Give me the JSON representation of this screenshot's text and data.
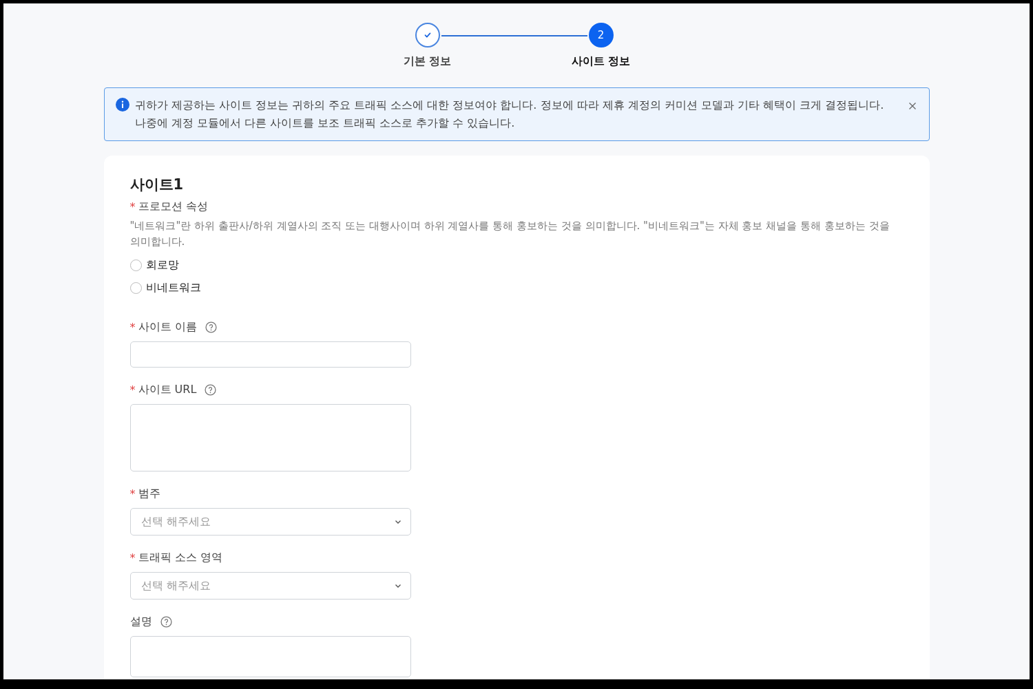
{
  "stepper": [
    {
      "completed": true,
      "selected": false,
      "label": "기본 정보"
    },
    {
      "completed": false,
      "selected": true,
      "number": "2",
      "label": "사이트 정보"
    }
  ],
  "notice": {
    "text": "귀하가 제공하는 사이트 정보는 귀하의 주요 트래픽 소스에 대한 정보여야 합니다. 정보에 따라 제휴 계정의 커미션 모델과 기타 혜택이 크게 결정됩니다. 나중에 계정 모듈에서 다른 사이트를 보조 트래픽 소스로 추가할 수 있습니다.",
    "closable": true
  },
  "form": {
    "title": "사이트1",
    "fields": [
      {
        "kind": "radio",
        "required_mark": "*",
        "label": "프로모션 속성",
        "help": false,
        "description": "\"네트워크\"란 하위 출판사/하위 계열사의 조직 또는 대행사이며 하위 계열사를 통해 홍보하는 것을 의미합니다. \"비네트워크\"는 자체 홍보 채널을 통해 홍보하는 것을 의미합니다.",
        "options": [
          {
            "label": "회로망",
            "selected": false
          },
          {
            "label": "비네트워크",
            "selected": false
          }
        ]
      },
      {
        "kind": "text",
        "required_mark": "*",
        "label": "사이트 이름",
        "help": true
      },
      {
        "kind": "textarea",
        "required_mark": "*",
        "label": "사이트 URL",
        "help": true
      },
      {
        "kind": "select",
        "required_mark": "*",
        "label": "범주",
        "help": false,
        "placeholder": "선택 해주세요"
      },
      {
        "kind": "select",
        "required_mark": "*",
        "label": "트래픽 소스 영역",
        "help": false,
        "placeholder": "선택 해주세요"
      },
      {
        "kind": "textarea",
        "label": "설명",
        "help": true
      }
    ]
  }
}
